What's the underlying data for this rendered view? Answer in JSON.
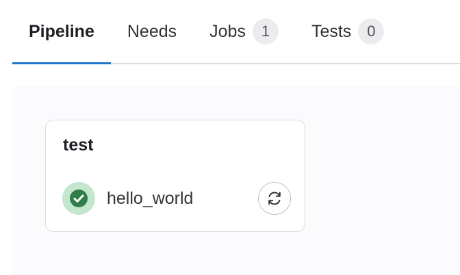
{
  "tabs": [
    {
      "label": "Pipeline",
      "active": true
    },
    {
      "label": "Needs"
    },
    {
      "label": "Jobs",
      "count": "1"
    },
    {
      "label": "Tests",
      "count": "0"
    }
  ],
  "stage": {
    "title": "test",
    "job": {
      "name": "hello_world",
      "status_icon": "status-success-icon",
      "action_icon": "retry-icon"
    }
  },
  "colors": {
    "active_tab_underline": "#1f75cb",
    "success": "#2f7d4a",
    "success_bg": "#c3e6cd"
  }
}
